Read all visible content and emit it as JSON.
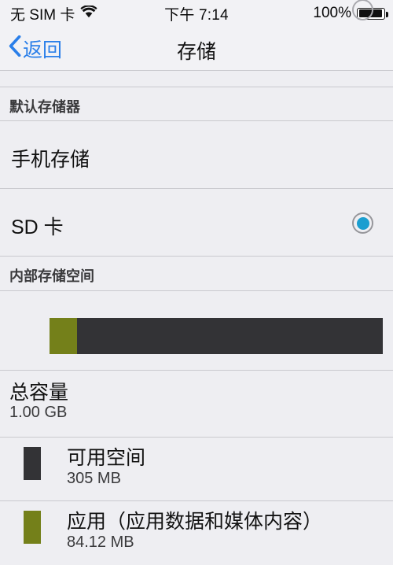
{
  "status_bar": {
    "carrier": "无 SIM 卡",
    "wifi_icon": "wifi-icon",
    "time": "下午 7:14",
    "battery_percent": "100%",
    "battery_icon": "battery-icon"
  },
  "nav_bar": {
    "back_label": "返回",
    "back_icon": "chevron-left-icon",
    "title": "存储"
  },
  "default_storage": {
    "header": "默认存储器",
    "options": [
      {
        "label": "手机存储",
        "selected": false
      },
      {
        "label": "SD 卡",
        "selected": true
      }
    ]
  },
  "internal_storage": {
    "header": "内部存储空间",
    "bar_segments": [
      {
        "name": "应用",
        "color": "#74801a",
        "percent": 8.2
      },
      {
        "name": "空闲",
        "color": "#333336",
        "percent": 91.8
      }
    ],
    "total": {
      "title": "总容量",
      "value": "1.00 GB"
    },
    "legend": [
      {
        "title": "可用空间",
        "value": "305 MB",
        "color": "#333336"
      },
      {
        "title": "应用（应用数据和媒体内容）",
        "value": "84.12 MB",
        "color": "#74801a"
      }
    ]
  },
  "colors": {
    "background": "#eeeef2",
    "separator": "#c9c9ce",
    "accent_blue": "#2a7fe9",
    "radio_blue": "#1b9ed0",
    "app_olive": "#74801a",
    "free_dark": "#333336"
  }
}
